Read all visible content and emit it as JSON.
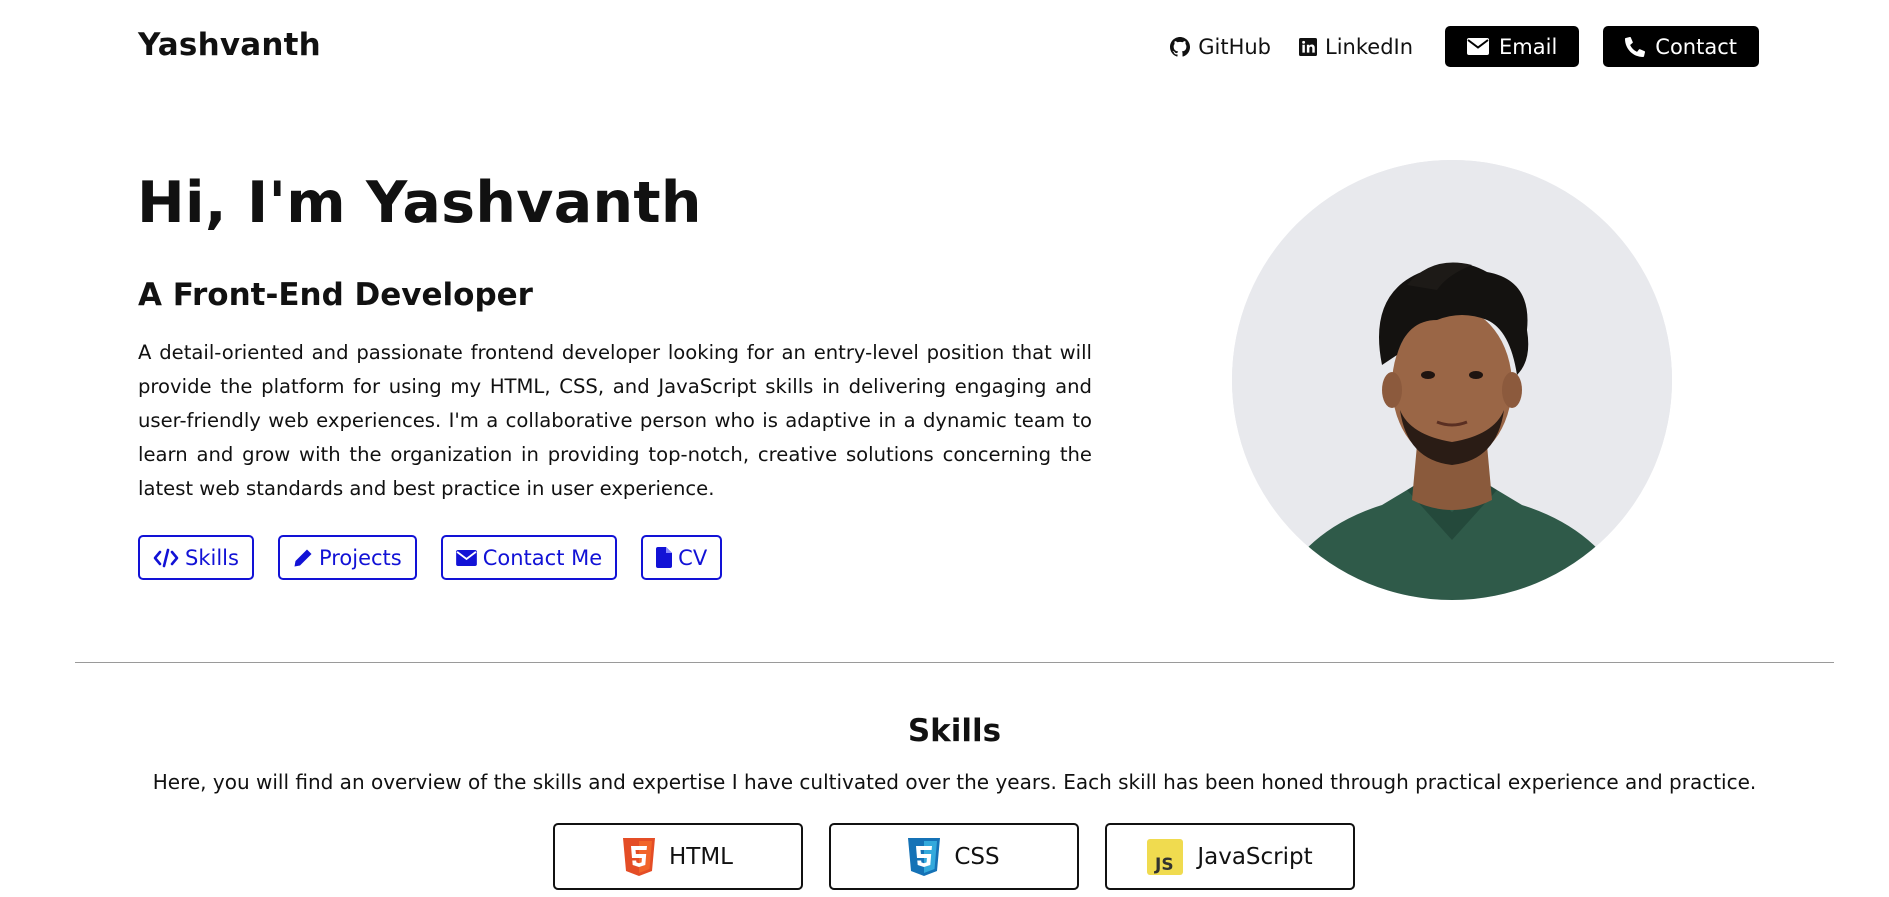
{
  "header": {
    "brand": "Yashvanth",
    "links": {
      "github": {
        "label": "GitHub",
        "icon": "github-icon"
      },
      "linkedin": {
        "label": "LinkedIn",
        "icon": "linkedin-icon"
      }
    },
    "buttons": {
      "email": {
        "label": "Email",
        "icon": "envelope-icon"
      },
      "contact": {
        "label": "Contact",
        "icon": "phone-icon"
      }
    }
  },
  "hero": {
    "title": "Hi, I'm Yashvanth",
    "subtitle": "A Front-End Developer",
    "description": "A detail-oriented and passionate frontend developer looking for an entry-level position that will provide the platform for using my HTML, CSS, and JavaScript skills in delivering engaging and user-friendly web experiences. I'm a collaborative person who is adaptive in a dynamic team to learn and grow with the organization in providing top-notch, creative solutions concerning the latest web standards and best practice in user experience.",
    "actions": {
      "skills": {
        "label": "Skills",
        "icon": "code-icon"
      },
      "projects": {
        "label": "Projects",
        "icon": "pencil-icon"
      },
      "contact_me": {
        "label": "Contact Me",
        "icon": "envelope-icon"
      },
      "cv": {
        "label": "CV",
        "icon": "file-icon"
      }
    },
    "accent_color": "#1212d6"
  },
  "skills": {
    "title": "Skills",
    "description": "Here, you will find an overview of the skills and expertise I have cultivated over the years. Each skill has been honed through practical experience and practice.",
    "items": [
      {
        "label": "HTML",
        "icon": "html5-icon",
        "color": "#e44d26"
      },
      {
        "label": "CSS",
        "icon": "css3-icon",
        "color": "#2965f1"
      },
      {
        "label": "JavaScript",
        "icon": "javascript-icon",
        "color": "#f0db4f"
      }
    ]
  }
}
